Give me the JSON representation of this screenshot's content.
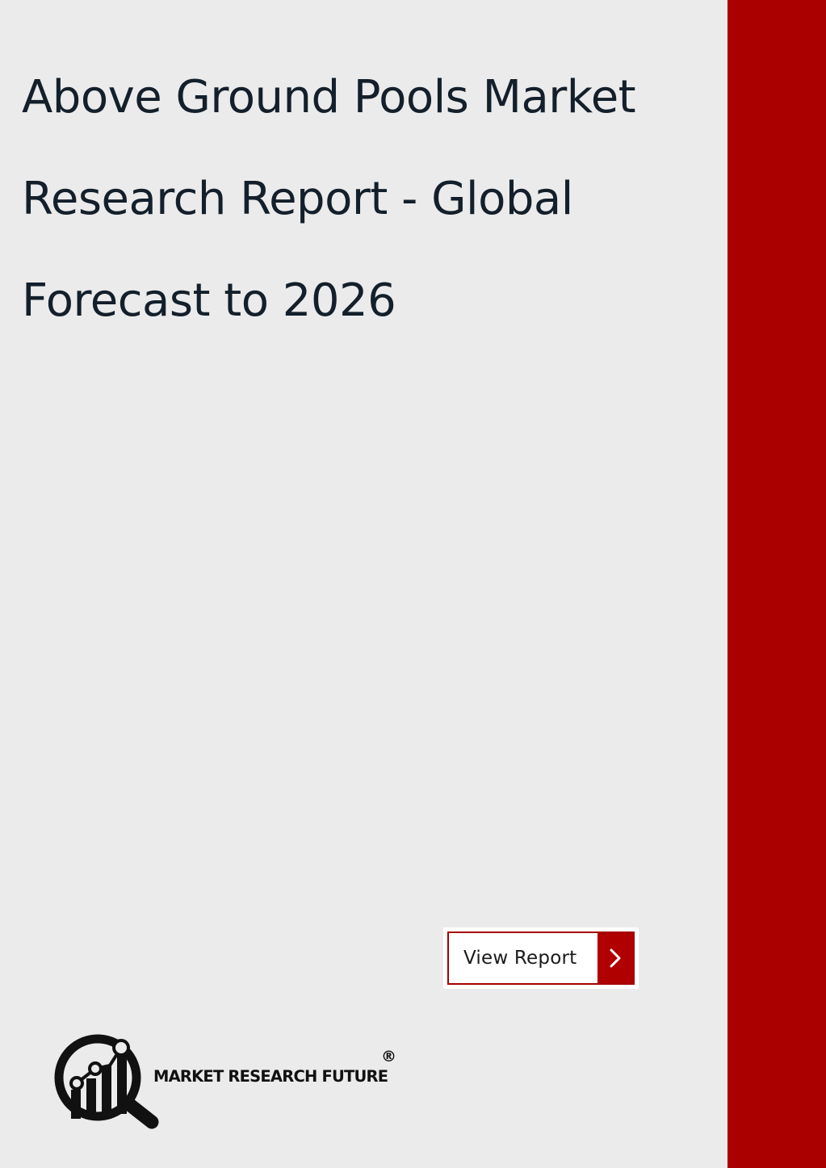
{
  "document": {
    "title_lines": [
      "Above Ground Pools Market",
      "Research Report - Global",
      "Forecast to 2026"
    ]
  },
  "cta": {
    "label": "View Report",
    "icon": "chevron-right-icon"
  },
  "brand": {
    "name": "MARKET RESEARCH FUTURE",
    "registered_mark": "®",
    "logo_icon": "magnifier-chart-icon"
  },
  "colors": {
    "background": "#ebebeb",
    "accent_band": "#ab0000",
    "title_text": "#13202b",
    "button_border": "#a60000",
    "button_arrow_bg": "#b00000"
  }
}
